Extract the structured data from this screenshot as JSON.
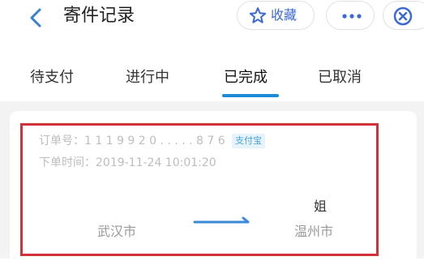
{
  "header": {
    "title": "寄件记录",
    "favorite_label": "收藏"
  },
  "tabs": [
    {
      "label": "待支付"
    },
    {
      "label": "进行中"
    },
    {
      "label": "已完成",
      "active": true
    },
    {
      "label": "已取消"
    }
  ],
  "order": {
    "number_text": "订单号：1 1 1 9 9 2 0 . . . . . 8 7 6",
    "payment_badge": "支付宝",
    "time_text": "下单时间：2019-11-24 10:01:20",
    "from_city": "武汉市",
    "to_name": "姐",
    "to_city": "温州市"
  },
  "colors": {
    "accent_blue": "#1d8bd6",
    "favorite_blue": "#3c69d3",
    "highlight_red": "#d1323a"
  },
  "icons": [
    "back-icon",
    "star-icon",
    "more-icon",
    "close-icon",
    "route-arrow-icon"
  ]
}
